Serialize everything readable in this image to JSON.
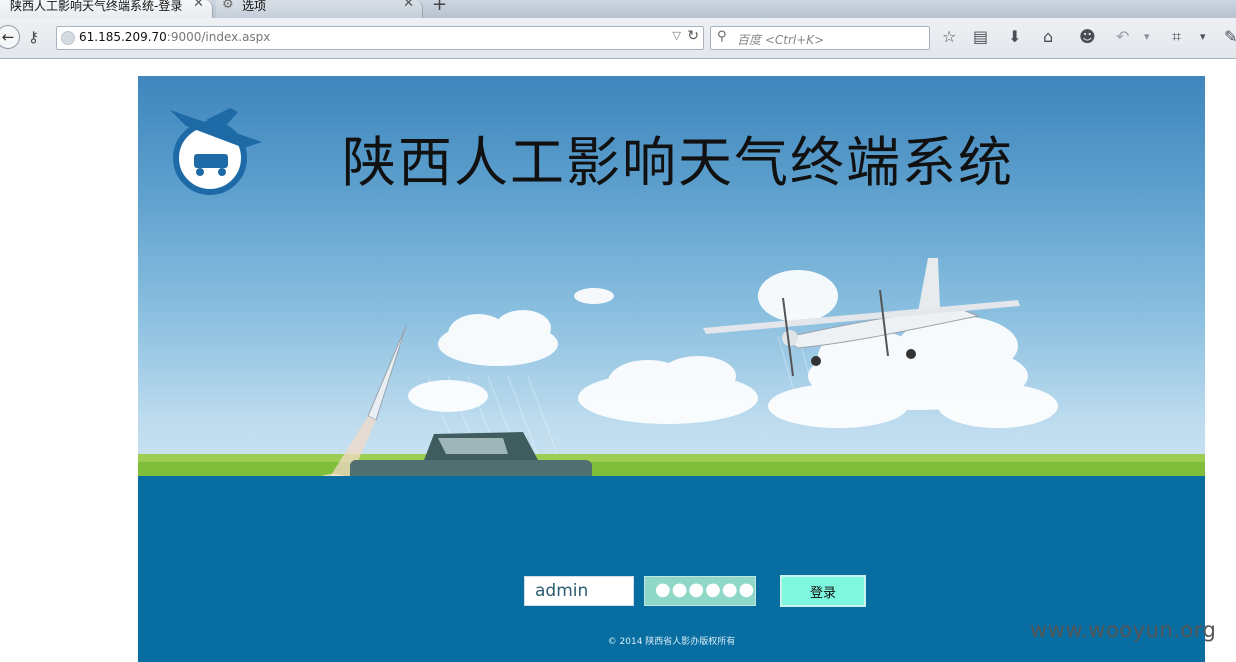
{
  "browser": {
    "tabs": [
      {
        "title": "陕西人工影响天气终端系统-登录",
        "active": true
      },
      {
        "title": "选项",
        "active": false
      }
    ],
    "new_tab": "+",
    "url_host": "61.185.209.70",
    "url_rest": ":9000/index.aspx",
    "search_placeholder": "百度 <Ctrl+K>"
  },
  "page": {
    "title": "陕西人工影响天气终端系统",
    "login": {
      "username_value": "admin",
      "password_mask": "●●●●●●",
      "submit_label": "登录"
    },
    "copyright": "© 2014 陕西省人影办版权所有",
    "colors": {
      "bottom_band": "#086ea2",
      "button": "#7ef7de",
      "password_field": "#8fd8c8"
    }
  },
  "watermark": "www.wooyun.org"
}
